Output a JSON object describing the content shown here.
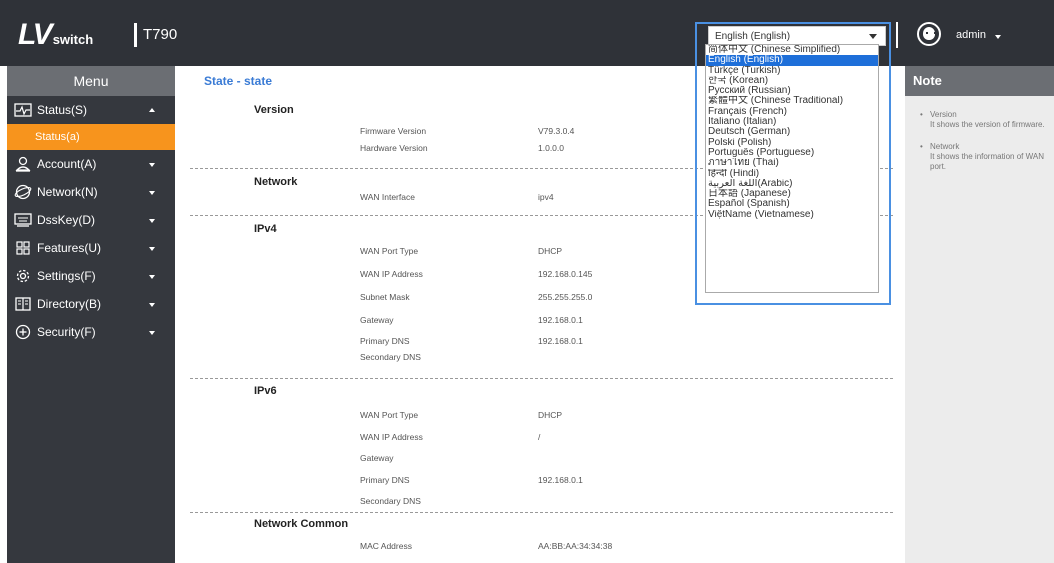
{
  "header": {
    "logo_text": "LV",
    "logo_sub": "switch",
    "model": "T790",
    "current_language": "English (English)",
    "user": "admin"
  },
  "sidebar": {
    "menu_title": "Menu",
    "items": [
      {
        "label": "Status(S)",
        "icon": "pulse-icon",
        "expanded": true
      },
      {
        "label": "Account(A)",
        "icon": "user-icon"
      },
      {
        "label": "Network(N)",
        "icon": "globe-icon"
      },
      {
        "label": "DssKey(D)",
        "icon": "keyboard-icon"
      },
      {
        "label": "Features(U)",
        "icon": "grid-icon"
      },
      {
        "label": "Settings(F)",
        "icon": "gear-icon"
      },
      {
        "label": "Directory(B)",
        "icon": "book-icon"
      },
      {
        "label": "Security(F)",
        "icon": "shield-plus-icon"
      }
    ],
    "submenu": {
      "label": "Status(a)"
    }
  },
  "main": {
    "title": "State - state",
    "version": {
      "title": "Version",
      "firmware_label": "Firmware Version",
      "firmware_value": "V79.3.0.4",
      "hardware_label": "Hardware Version",
      "hardware_value": "1.0.0.0"
    },
    "network": {
      "title": "Network",
      "wan_label": "WAN Interface",
      "wan_value": "ipv4"
    },
    "ipv4": {
      "title": "IPv4",
      "port_type_label": "WAN Port Type",
      "port_type_value": "DHCP",
      "ip_label": "WAN IP Address",
      "ip_value": "192.168.0.145",
      "mask_label": "Subnet Mask",
      "mask_value": "255.255.255.0",
      "gateway_label": "Gateway",
      "gateway_value": "192.168.0.1",
      "pdns_label": "Primary DNS",
      "pdns_value": "192.168.0.1",
      "sdns_label": "Secondary DNS"
    },
    "ipv6": {
      "title": "IPv6",
      "port_type_label": "WAN Port Type",
      "port_type_value": "DHCP",
      "ip_label": "WAN IP Address",
      "ip_value": "/",
      "gateway_label": "Gateway",
      "pdns_label": "Primary DNS",
      "pdns_value": "192.168.0.1",
      "sdns_label": "Secondary DNS"
    },
    "network_common": {
      "title": "Network Common",
      "mac_label": "MAC Address",
      "mac_value": "AA:BB:AA:34:34:38"
    }
  },
  "note": {
    "title": "Note",
    "items": [
      {
        "title": "Version",
        "text": "It shows the version of firmware."
      },
      {
        "title": "Network",
        "text": "It shows the information of WAN port."
      }
    ]
  },
  "language_dropdown": {
    "selected_index": 1,
    "options": [
      "简体中文 (Chinese Simplified)",
      "English (English)",
      "Türkçe (Turkish)",
      "한국 (Korean)",
      "Русский (Russian)",
      "繁體中文 (Chinese Traditional)",
      "Français (French)",
      "Italiano (Italian)",
      "Deutsch (German)",
      "Polski (Polish)",
      "Português (Portuguese)",
      "ภาษาไทย (Thai)",
      "हिन्दी (Hindi)",
      "اللغة العربية(Arabic)",
      "日本語 (Japanese)",
      "Español (Spanish)",
      "ViệtName (Vietnamese)"
    ]
  },
  "colors": {
    "header_bg": "#2f3238",
    "sidebar_bg": "#35383e",
    "active_submenu": "#f7941d",
    "accent_blue": "#3a7bd5",
    "selected_option": "#1e6fd9"
  }
}
